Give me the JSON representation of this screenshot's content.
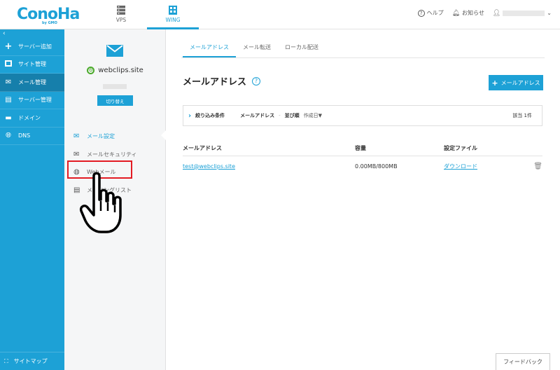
{
  "header": {
    "logo": "ConoHa",
    "logo_sub": "by GMO",
    "services": [
      {
        "label": "VPS",
        "icon": "server-icon"
      },
      {
        "label": "WING",
        "icon": "wing-icon"
      }
    ],
    "help": "ヘルプ",
    "notice": "お知らせ"
  },
  "sidebar": {
    "collapse": "‹",
    "items": [
      {
        "label": "サーバー追加",
        "icon": "plus-icon"
      },
      {
        "label": "サイト管理",
        "icon": "site-icon"
      },
      {
        "label": "メール管理",
        "icon": "mail-icon"
      },
      {
        "label": "サーバー管理",
        "icon": "server-icon"
      },
      {
        "label": "ドメイン",
        "icon": "domain-icon"
      },
      {
        "label": "DNS",
        "icon": "globe-icon"
      }
    ],
    "active_index": 2,
    "sitemap": "サイトマップ"
  },
  "domain_panel": {
    "domain": "webclips.site",
    "switch_button": "切り替え",
    "menu": [
      {
        "label": "メール設定",
        "icon": "mail-settings-icon"
      },
      {
        "label": "メールセキュリティ",
        "icon": "shield-icon"
      },
      {
        "label": "Webメール",
        "icon": "webmail-icon"
      },
      {
        "label": "メーリングリスト",
        "icon": "mailing-list-icon"
      }
    ]
  },
  "main": {
    "tabs": [
      "メールアドレス",
      "メール転送",
      "ローカル配送"
    ],
    "title": "メールアドレス",
    "help_mark": "?",
    "add_button": "メールアドレス",
    "filter": {
      "title": "絞り込み条件",
      "field": "メールアドレス",
      "dash": "-",
      "sort_label": "並び順",
      "sort_value": "作成日▼",
      "count": "該当 1件"
    },
    "table": {
      "headers": [
        "メールアドレス",
        "容量",
        "設定ファイル"
      ],
      "rows": [
        {
          "email": "test@webclips.site",
          "capacity": "0.00MB/800MB",
          "settings": "ダウンロード"
        }
      ]
    },
    "feedback": "フィードバック"
  },
  "colors": {
    "accent": "#1da1d6",
    "sidebar_active": "#167fab",
    "highlight": "#e31b23"
  }
}
